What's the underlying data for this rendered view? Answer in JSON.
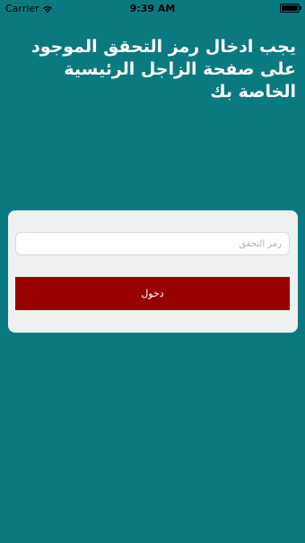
{
  "status_bar": {
    "carrier": "Carrier",
    "wifi_icon": "wifi-icon",
    "time": "9:39 AM",
    "battery_icon": "battery-icon"
  },
  "heading": {
    "text": "يجب ادخال رمز التحقق الموجود على صفحة الزاجل الرئيسية الخاصة بك"
  },
  "form": {
    "code_input": {
      "placeholder": "رمز التحقق",
      "value": ""
    },
    "submit_label": "دخول"
  },
  "colors": {
    "background": "#0b7a80",
    "card": "#eef1f0",
    "button": "#990000",
    "heading_text": "#ffffff"
  }
}
